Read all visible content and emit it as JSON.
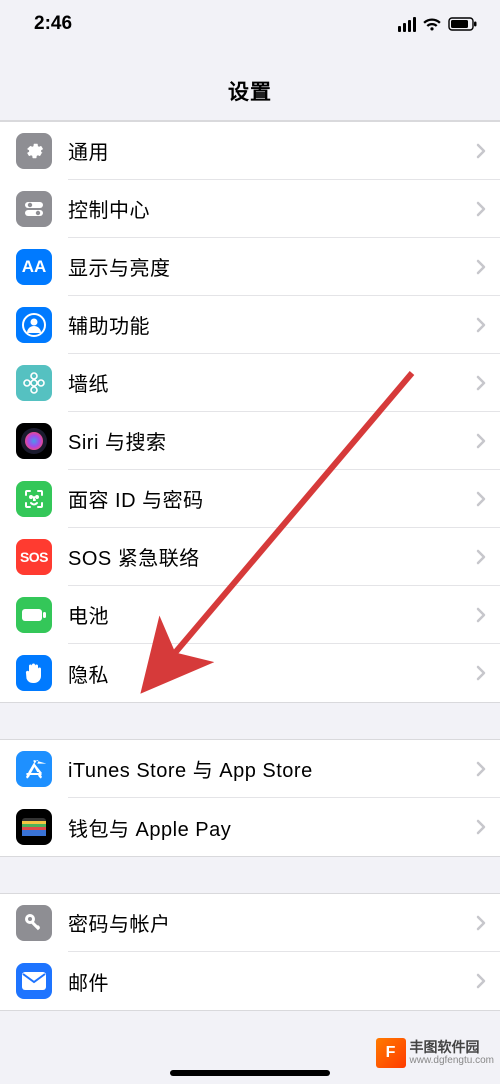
{
  "status": {
    "time": "2:46"
  },
  "header": {
    "title": "设置"
  },
  "groups": [
    {
      "items": [
        {
          "name": "row-general",
          "icon": "gear",
          "color": "#8e8e93",
          "label": "通用"
        },
        {
          "name": "row-control-center",
          "icon": "switches",
          "color": "#8e8e93",
          "label": "控制中心"
        },
        {
          "name": "row-display",
          "icon": "aa",
          "color": "#007aff",
          "label": "显示与亮度"
        },
        {
          "name": "row-accessibility",
          "icon": "person-circle",
          "color": "#007aff",
          "label": "辅助功能"
        },
        {
          "name": "row-wallpaper",
          "icon": "flower",
          "color": "#55c1c1",
          "label": "墙纸"
        },
        {
          "name": "row-siri",
          "icon": "siri",
          "color": "#000000",
          "label": "Siri 与搜索"
        },
        {
          "name": "row-faceid",
          "icon": "faceid",
          "color": "#34c759",
          "label": "面容 ID 与密码"
        },
        {
          "name": "row-sos",
          "icon": "sos",
          "color": "#ff3b30",
          "label": "SOS 紧急联络"
        },
        {
          "name": "row-battery",
          "icon": "battery",
          "color": "#34c759",
          "label": "电池"
        },
        {
          "name": "row-privacy",
          "icon": "hand",
          "color": "#007aff",
          "label": "隐私"
        }
      ]
    },
    {
      "items": [
        {
          "name": "row-itunes",
          "icon": "appstore",
          "color": "#1e90ff",
          "label": "iTunes Store 与 App Store"
        },
        {
          "name": "row-wallet",
          "icon": "wallet",
          "color": "#000000",
          "label": "钱包与 Apple Pay"
        }
      ]
    },
    {
      "items": [
        {
          "name": "row-accounts",
          "icon": "key",
          "color": "#8e8e93",
          "label": "密码与帐户"
        },
        {
          "name": "row-mail",
          "icon": "mail",
          "color": "#1e74ff",
          "label": "邮件"
        }
      ]
    }
  ],
  "watermark": {
    "title": "丰图软件园",
    "url": "www.dgfengtu.com"
  }
}
